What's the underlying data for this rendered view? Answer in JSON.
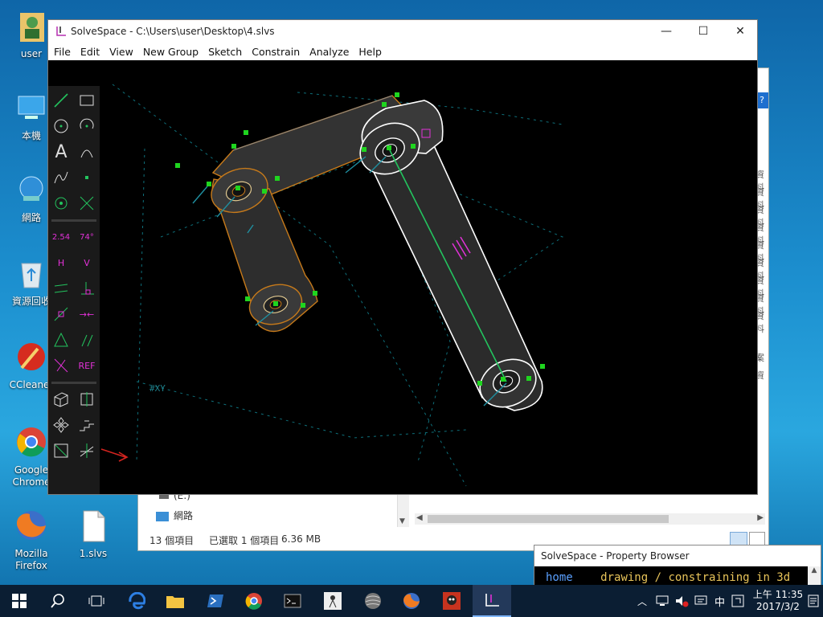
{
  "desktop": {
    "icons": [
      {
        "label": "user"
      },
      {
        "label": "本機"
      },
      {
        "label": "網路"
      },
      {
        "label": "資源回收"
      },
      {
        "label": "CCleaner"
      },
      {
        "label": "Google Chrome"
      },
      {
        "label": "Mozilla Firefox"
      },
      {
        "label": "1.slvs"
      }
    ]
  },
  "explorer": {
    "drive_item": "(E:)",
    "network_item": "網路",
    "status_count": "13 個項目",
    "status_selected": "已選取 1 個項目",
    "status_size": "6.36 MB",
    "side_snippets": [
      "資料",
      "資料",
      "資料",
      "資料",
      "資料",
      "資料",
      "資料",
      "資料",
      "資料",
      "案",
      "資"
    ]
  },
  "solvespace": {
    "title": "SolveSpace - C:\\Users\\user\\Desktop\\4.slvs",
    "menu": [
      "File",
      "Edit",
      "View",
      "New Group",
      "Sketch",
      "Constrain",
      "Analyze",
      "Help"
    ],
    "toolbar": {
      "dimension_label": "2.54",
      "angle_label": "74°",
      "horizontal_label": "H",
      "vertical_label": "V",
      "ref_label": "REF"
    },
    "viewport": {
      "plane_label": "#XY"
    }
  },
  "property_browser": {
    "title": "SolveSpace - Property Browser",
    "home_link": "home",
    "breadcrumb": "drawing / constraining in 3d"
  },
  "taskbar": {
    "ime_label": "中",
    "time": "上午 11:35",
    "date": "2017/3/2"
  },
  "colors": {
    "accent_green": "#23c45e",
    "constraint_magenta": "#e331d8",
    "model_orange": "#c77a1a",
    "normal_teal": "#1f8fa0"
  }
}
